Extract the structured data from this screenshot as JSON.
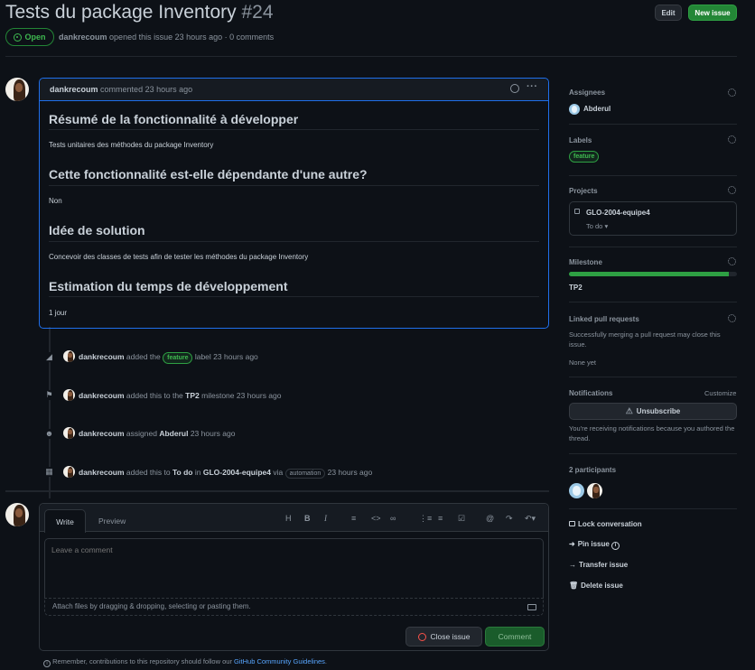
{
  "issue": {
    "title": "Tests du package Inventory",
    "number": "#24",
    "state": "Open",
    "author": "dankrecoum",
    "meta": "opened this issue 23 hours ago · 0 comments"
  },
  "header_buttons": {
    "edit": "Edit",
    "new_issue": "New issue"
  },
  "comment": {
    "author": "dankrecoum",
    "time": "commented 23 hours ago",
    "sections": [
      {
        "heading": "Résumé de la fonctionnalité à développer",
        "body": "Tests unitaires des méthodes du package Inventory"
      },
      {
        "heading": "Cette fonctionnalité est-elle dépendante d'une autre?",
        "body": "Non"
      },
      {
        "heading": "Idée de solution",
        "body": "Concevoir des classes de tests afin de tester les méthodes du package Inventory"
      },
      {
        "heading": "Estimation du temps de développement",
        "body": "1 jour"
      }
    ]
  },
  "timeline": [
    {
      "icon": "tag-icon",
      "user": "dankrecoum",
      "pre": "added the",
      "label": "feature",
      "post": "label 23 hours ago"
    },
    {
      "icon": "milestone-icon",
      "user": "dankrecoum",
      "pre": "added this to the",
      "strong": "TP2",
      "post": "milestone 23 hours ago"
    },
    {
      "icon": "person-icon",
      "user": "dankrecoum",
      "pre": "assigned",
      "strong": "Abderul",
      "post": "23 hours ago"
    },
    {
      "icon": "project-icon",
      "user": "dankrecoum",
      "pre": "added this to",
      "strong": "To do",
      "mid": "in",
      "strong2": "GLO-2004-equipe4",
      "via": "via",
      "badge": "automation",
      "post": "23 hours ago"
    }
  ],
  "editor": {
    "tab_write": "Write",
    "tab_preview": "Preview",
    "placeholder": "Leave a comment",
    "attach_hint": "Attach files by dragging & dropping, selecting or pasting them.",
    "close_button": "Close issue",
    "comment_button": "Comment",
    "guidelines_pre": "Remember, contributions to this repository should follow our",
    "guidelines_link": "GitHub Community Guidelines",
    "guidelines_post": "."
  },
  "sidebar": {
    "assignees_title": "Assignees",
    "assignee": "Abderul",
    "labels_title": "Labels",
    "label": "feature",
    "projects_title": "Projects",
    "project_name": "GLO-2004-equipe4",
    "project_status": "To do",
    "milestone_title": "Milestone",
    "milestone_name": "TP2",
    "milestone_progress": 0.95,
    "linked_title": "Linked pull requests",
    "linked_desc": "Successfully merging a pull request may close this issue.",
    "linked_none": "None yet",
    "notifications_title": "Notifications",
    "customize": "Customize",
    "unsubscribe": "Unsubscribe",
    "notif_desc": "You're receiving notifications because you authored the thread.",
    "participants_title": "2 participants",
    "lock": "Lock conversation",
    "pin": "Pin issue",
    "transfer": "Transfer issue",
    "delete": "Delete issue"
  },
  "colors": {
    "background": "#0d1117",
    "green": "#238636",
    "open_badge": "#3fb950",
    "link": "#58a6ff",
    "danger": "#f85149",
    "border": "#30363d"
  }
}
